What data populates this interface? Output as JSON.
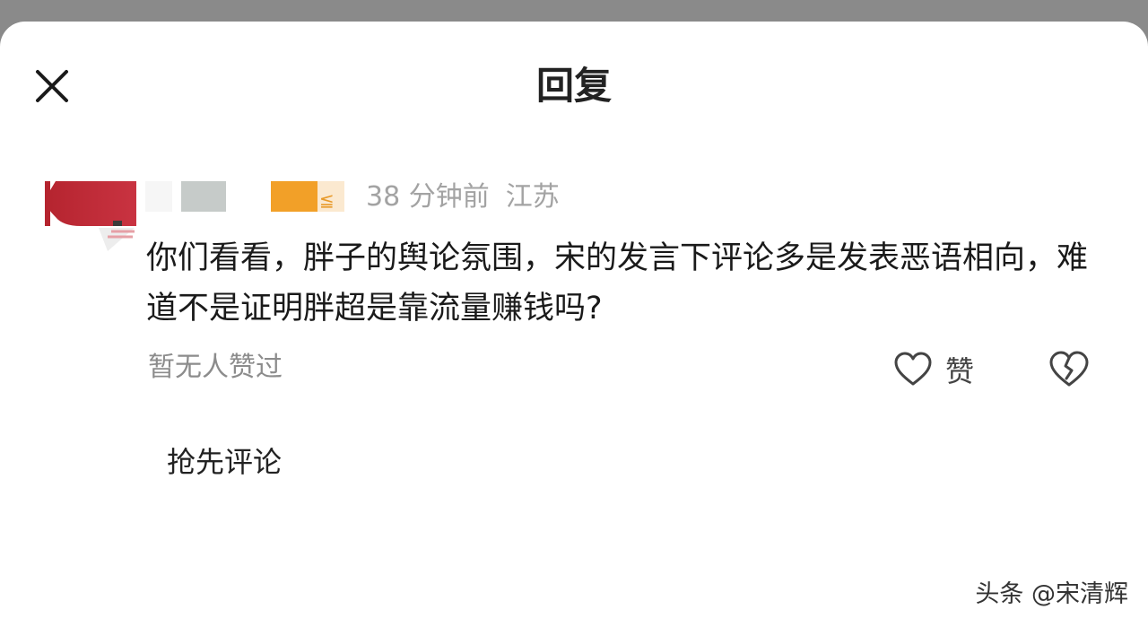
{
  "header": {
    "title": "回复",
    "close_icon": "close-icon"
  },
  "comment": {
    "time": "38 分钟前",
    "location": "江苏",
    "text": "你们看看，胖子的舆论氛围，宋的发言下评论多是发表恶语相向，难道不是证明胖超是靠流量赚钱吗?",
    "likes_status": "暂无人赞过",
    "like_label": "赞",
    "like_icon": "heart-outline-icon",
    "dislike_icon": "broken-heart-icon"
  },
  "reply": {
    "first_comment_label": "抢先评论"
  },
  "watermark": {
    "text": "头条 @宋清辉"
  },
  "colors": {
    "meta_gray": "#a3a3a3",
    "badge_orange": "#f2a028",
    "avatar_red": "#b5242f"
  }
}
